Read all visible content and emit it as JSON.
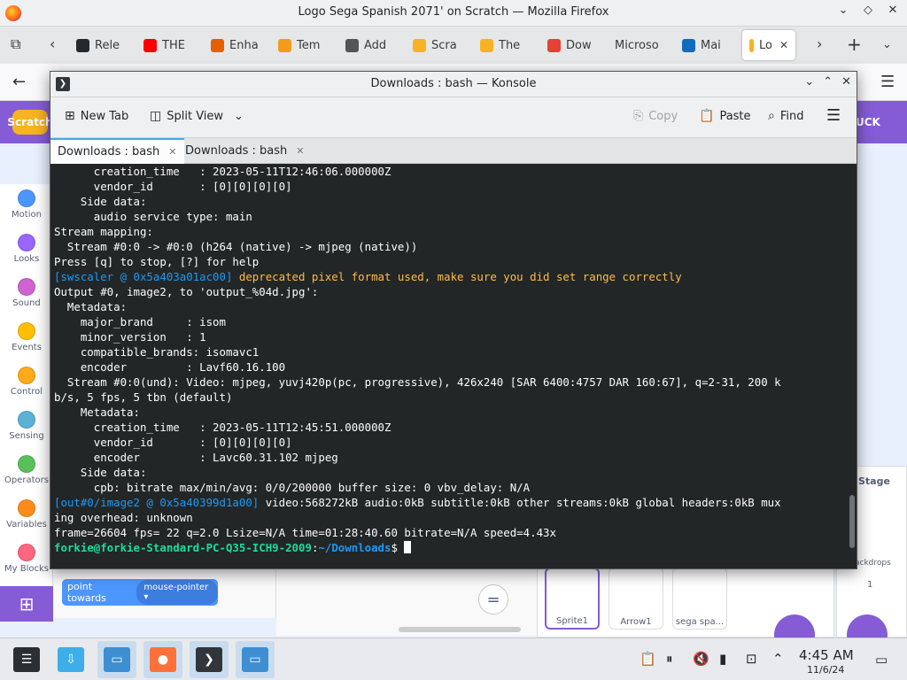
{
  "firefox": {
    "window_title": "Logo Sega Spanish 2071' on Scratch — Mozilla Firefox",
    "tabs": [
      {
        "label": "Rele",
        "icon": "github-icon",
        "color": "#24292e"
      },
      {
        "label": "THE",
        "icon": "youtube-icon",
        "color": "#ff0000"
      },
      {
        "label": "Enha",
        "icon": "firefox-addon-icon",
        "color": "#e66000"
      },
      {
        "label": "Tem",
        "icon": "mail-icon",
        "color": "#f29d1c"
      },
      {
        "label": "Add",
        "icon": "puzzle-icon",
        "color": "#555555"
      },
      {
        "label": "Scra",
        "icon": "scratch-icon",
        "color": "#f7b321"
      },
      {
        "label": "The",
        "icon": "scratch-icon",
        "color": "#f7b321"
      },
      {
        "label": "Dow",
        "icon": "x-icon",
        "color": "#e34234"
      },
      {
        "label": "Microso",
        "icon": "",
        "color": ""
      },
      {
        "label": "Mai",
        "icon": "outlook-icon",
        "color": "#0f6cbd"
      },
      {
        "label": "Lo",
        "icon": "scratch-icon",
        "color": "#f7b321",
        "active": true
      }
    ]
  },
  "scratch": {
    "logo_text": "Scratch",
    "menubar_right": "UCK",
    "categories": [
      {
        "label": "Motion",
        "color": "#4c97ff"
      },
      {
        "label": "Looks",
        "color": "#9966ff"
      },
      {
        "label": "Sound",
        "color": "#cf63cf"
      },
      {
        "label": "Events",
        "color": "#ffbf00"
      },
      {
        "label": "Control",
        "color": "#ffab19"
      },
      {
        "label": "Sensing",
        "color": "#5cb1d6"
      },
      {
        "label": "Operators",
        "color": "#59c059"
      },
      {
        "label": "Variables",
        "color": "#ff8c1a"
      },
      {
        "label": "My Blocks",
        "color": "#ff6680"
      }
    ],
    "block": {
      "label": "point towards",
      "dropdown": "mouse-pointer"
    },
    "zoom_reset": "=",
    "sprites": [
      {
        "label": "Sprite1"
      },
      {
        "label": "Arrow1"
      },
      {
        "label": "sega spa..."
      }
    ],
    "stage": {
      "title": "Stage",
      "backdrops_label": "ackdrops",
      "backdrops_count": "1"
    }
  },
  "konsole": {
    "title": "Downloads : bash — Konsole",
    "toolbar": {
      "new_tab": "New Tab",
      "split_view": "Split View",
      "copy": "Copy",
      "paste": "Paste",
      "find": "Find"
    },
    "tabs": [
      {
        "label": "Downloads : bash",
        "active": true
      },
      {
        "label": "Downloads : bash",
        "active": false
      }
    ],
    "lines": [
      {
        "segs": [
          {
            "t": "      creation_time   : 2023-05-11T12:46:06.000000Z",
            "c": ""
          }
        ]
      },
      {
        "segs": [
          {
            "t": "      vendor_id       : [0][0][0][0]",
            "c": ""
          }
        ]
      },
      {
        "segs": [
          {
            "t": "    Side data:",
            "c": ""
          }
        ]
      },
      {
        "segs": [
          {
            "t": "      audio service type: main",
            "c": ""
          }
        ]
      },
      {
        "segs": [
          {
            "t": "Stream mapping:",
            "c": ""
          }
        ]
      },
      {
        "segs": [
          {
            "t": "  Stream #0:0 -> #0:0 (h264 (native) -> mjpeg (native))",
            "c": ""
          }
        ]
      },
      {
        "segs": [
          {
            "t": "Press [q] to stop, [?] for help",
            "c": ""
          }
        ]
      },
      {
        "segs": [
          {
            "t": "[swscaler @ 0x5a403a01ac00] ",
            "c": "c-blue"
          },
          {
            "t": "deprecated pixel format used, make sure you did set range correctly",
            "c": "c-yellow"
          }
        ]
      },
      {
        "segs": [
          {
            "t": "Output #0, image2, to 'output_%04d.jpg':",
            "c": ""
          }
        ]
      },
      {
        "segs": [
          {
            "t": "  Metadata:",
            "c": ""
          }
        ]
      },
      {
        "segs": [
          {
            "t": "    major_brand     : isom",
            "c": ""
          }
        ]
      },
      {
        "segs": [
          {
            "t": "    minor_version   : 1",
            "c": ""
          }
        ]
      },
      {
        "segs": [
          {
            "t": "    compatible_brands: isomavc1",
            "c": ""
          }
        ]
      },
      {
        "segs": [
          {
            "t": "    encoder         : Lavf60.16.100",
            "c": ""
          }
        ]
      },
      {
        "segs": [
          {
            "t": "  Stream #0:0(und): Video: mjpeg, yuvj420p(pc, progressive), 426x240 [SAR 6400:4757 DAR 160:67], q=2-31, 200 k",
            "c": ""
          }
        ]
      },
      {
        "segs": [
          {
            "t": "b/s, 5 fps, 5 tbn (default)",
            "c": ""
          }
        ]
      },
      {
        "segs": [
          {
            "t": "    Metadata:",
            "c": ""
          }
        ]
      },
      {
        "segs": [
          {
            "t": "      creation_time   : 2023-05-11T12:45:51.000000Z",
            "c": ""
          }
        ]
      },
      {
        "segs": [
          {
            "t": "      vendor_id       : [0][0][0][0]",
            "c": ""
          }
        ]
      },
      {
        "segs": [
          {
            "t": "      encoder         : Lavc60.31.102 mjpeg",
            "c": ""
          }
        ]
      },
      {
        "segs": [
          {
            "t": "    Side data:",
            "c": ""
          }
        ]
      },
      {
        "segs": [
          {
            "t": "      cpb: bitrate max/min/avg: 0/0/200000 buffer size: 0 vbv_delay: N/A",
            "c": ""
          }
        ]
      },
      {
        "segs": [
          {
            "t": "[out#0/image2 @ 0x5a40399d1a00] ",
            "c": "c-blue"
          },
          {
            "t": "video:568272kB audio:0kB subtitle:0kB other streams:0kB global headers:0kB mux",
            "c": ""
          }
        ]
      },
      {
        "segs": [
          {
            "t": "ing overhead: unknown",
            "c": ""
          }
        ]
      },
      {
        "segs": [
          {
            "t": "frame=26604 fps= 22 q=2.0 Lsize=N/A time=01:28:40.60 bitrate=N/A speed=4.43x",
            "c": ""
          }
        ]
      },
      {
        "segs": [
          {
            "t": "forkie@forkie-Standard-PC-Q35-ICH9-2009",
            "c": "c-green"
          },
          {
            "t": ":",
            "c": ""
          },
          {
            "t": "~/Downloads",
            "c": "c-pathblue"
          },
          {
            "t": "$ ",
            "c": ""
          }
        ],
        "cursor": true
      }
    ]
  },
  "taskbar": {
    "apps": [
      {
        "name": "application-launcher-icon",
        "color": "#2b2f33",
        "glyph": "☰"
      },
      {
        "name": "discover-icon",
        "color": "#3daee9",
        "glyph": "⇩"
      },
      {
        "name": "dolphin-icon",
        "color": "#3d8fd1",
        "glyph": "▭",
        "active": true
      },
      {
        "name": "firefox-icon",
        "color": "#ff7139",
        "glyph": "●",
        "active": true
      },
      {
        "name": "konsole-icon",
        "color": "#31363b",
        "glyph": "❯",
        "active": true
      },
      {
        "name": "dolphin-icon",
        "color": "#3d8fd1",
        "glyph": "▭",
        "active": true
      }
    ],
    "tray_icons": [
      "clipboard-icon",
      "media-pause-icon",
      "volume-muted-icon",
      "battery-icon",
      "network-icon",
      "chevron-up-icon"
    ],
    "time": "4:45 AM",
    "date": "11/6/24"
  }
}
